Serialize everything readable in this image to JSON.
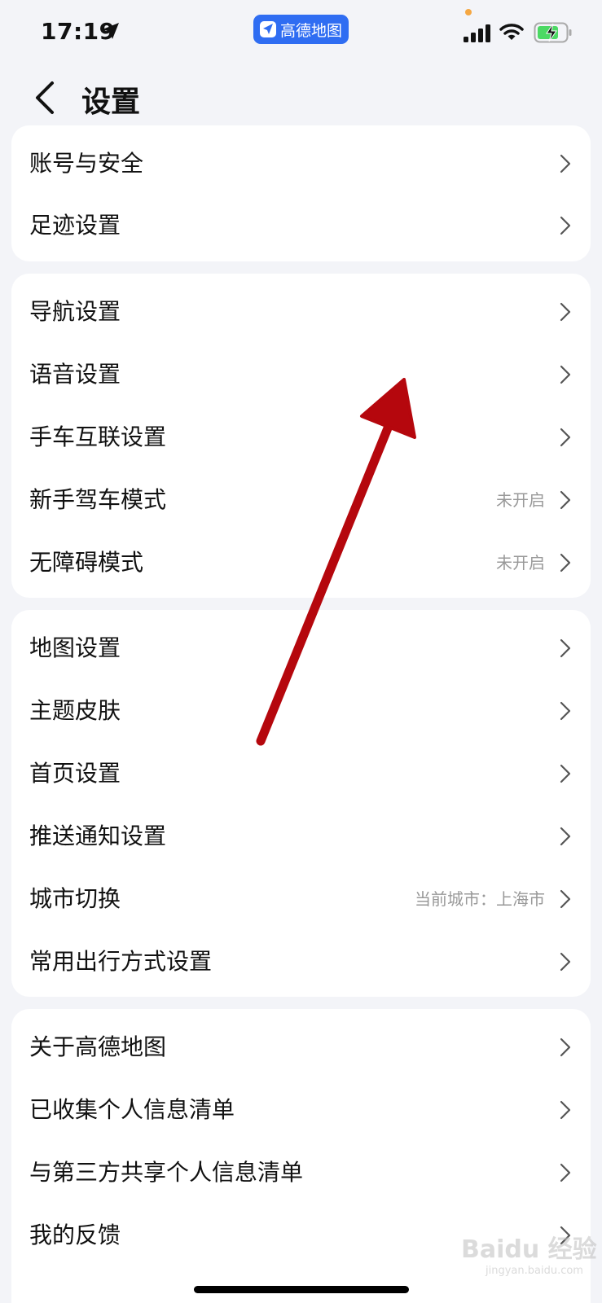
{
  "status_bar": {
    "time": "17:19",
    "app_pill": "高德地图",
    "accent": "#2f6df2",
    "battery_color": "#4cd964"
  },
  "header": {
    "title": "设置"
  },
  "groups": [
    {
      "items": [
        {
          "label": "账号与安全"
        },
        {
          "label": "足迹设置"
        }
      ]
    },
    {
      "items": [
        {
          "label": "导航设置"
        },
        {
          "label": "语音设置"
        },
        {
          "label": "手车互联设置"
        },
        {
          "label": "新手驾车模式",
          "value": "未开启"
        },
        {
          "label": "无障碍模式",
          "value": "未开启"
        }
      ]
    },
    {
      "items": [
        {
          "label": "地图设置"
        },
        {
          "label": "主题皮肤"
        },
        {
          "label": "首页设置"
        },
        {
          "label": "推送通知设置"
        },
        {
          "label": "城市切换",
          "value": "当前城市：上海市"
        },
        {
          "label": "常用出行方式设置"
        }
      ]
    },
    {
      "items": [
        {
          "label": "关于高德地图"
        },
        {
          "label": "已收集个人信息清单"
        },
        {
          "label": "与第三方共享个人信息清单"
        },
        {
          "label": "我的反馈"
        }
      ]
    }
  ],
  "watermark": {
    "text": "Baidu 经验",
    "sub": "jingyan.baidu.com"
  },
  "annotation_color": "#b5070d"
}
